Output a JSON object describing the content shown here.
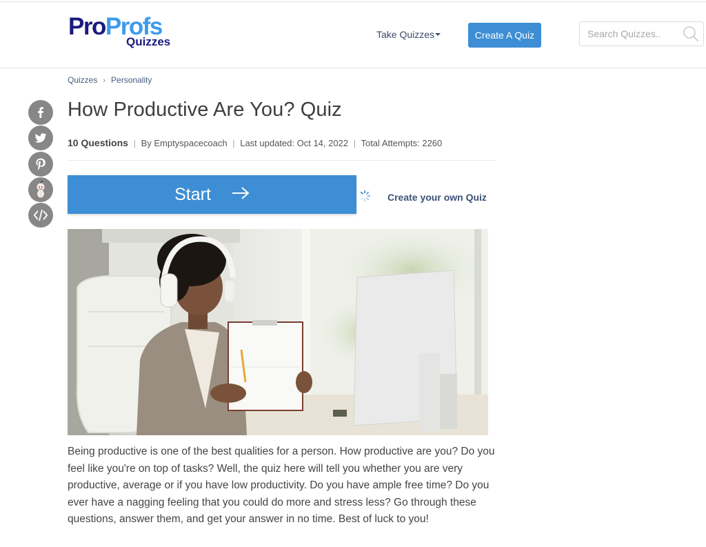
{
  "header": {
    "logo": {
      "part1": "Pro",
      "part2": "Profs",
      "sub": "Quizzes"
    },
    "nav_take_quizzes": "Take Quizzes",
    "create_quiz_button": "Create A Quiz",
    "search": {
      "placeholder": "Search Quizzes..",
      "value": ""
    }
  },
  "breadcrumb": {
    "items": [
      "Quizzes",
      "Personality"
    ],
    "separator": "›"
  },
  "quiz": {
    "title": "How Productive Are You? Quiz",
    "questions": "10 Questions",
    "separator": "|",
    "author": "By Emptyspacecoach",
    "last_updated": "Last updated: Oct 14, 2022",
    "attempts": "Total Attempts: 2260",
    "start_label": "Start",
    "create_own_label": "Create your own Quiz",
    "description": "Being productive is one of the best qualities for a person. How productive are you? Do you feel like you're on top of tasks? Well, the quiz here will tell you whether you are very productive, average or if you have low productivity. Do you have ample free time? Do you ever have a nagging feeling that you could do more and stress less? Go through these questions, answer them, and get your answer in no time. Best of luck to you!"
  },
  "social_share": [
    {
      "name": "facebook",
      "icon": "facebook-icon"
    },
    {
      "name": "twitter",
      "icon": "twitter-icon"
    },
    {
      "name": "pinterest",
      "icon": "pinterest-icon"
    },
    {
      "name": "reddit",
      "icon": "reddit-icon"
    },
    {
      "name": "embed",
      "icon": "embed-code-icon"
    }
  ],
  "hero_image": {
    "alt": "Woman wearing headphones holding a clipboard in front of a computer"
  },
  "colors": {
    "brand_dark": "#1a1a7e",
    "brand_light": "#3d9bec",
    "button_blue": "#3d8ed4",
    "social_gray": "#878787"
  }
}
